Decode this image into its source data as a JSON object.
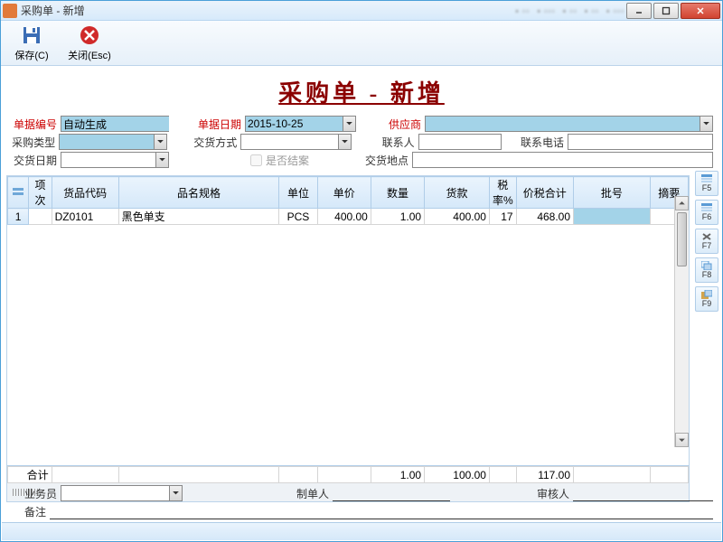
{
  "window_title": "采购单 - 新增",
  "toolbar": {
    "save": "保存(C)",
    "close": "关闭(Esc)"
  },
  "doc_title": "采购单 - 新增",
  "form": {
    "labels": {
      "doc_no": "单据编号",
      "doc_date": "单据日期",
      "supplier": "供应商",
      "ptype": "采购类型",
      "dmethod": "交货方式",
      "contact": "联系人",
      "phone": "联系电话",
      "ddate": "交货日期",
      "closed": "是否结案",
      "daddr": "交货地点"
    },
    "doc_no": "自动生成",
    "doc_date": "2015-10-25"
  },
  "columns": {
    "seq": "项次",
    "code": "货品代码",
    "name": "品名规格",
    "unit": "单位",
    "price": "单价",
    "qty": "数量",
    "amount": "货款",
    "rate": "税率%",
    "total": "价税合计",
    "batch": "批号",
    "note": "摘要"
  },
  "rows": [
    {
      "n": "1",
      "code": "DZ0101",
      "name": "黑色单支",
      "unit": "PCS",
      "price": "400.00",
      "qty": "1.00",
      "amount": "400.00",
      "rate": "17",
      "total": "468.00"
    }
  ],
  "sum": {
    "label": "合计",
    "qty": "1.00",
    "amount": "100.00",
    "total": "117.00"
  },
  "bottom": {
    "operator": "业务员",
    "maker": "制单人",
    "reviewer": "审核人",
    "remark": "备注"
  },
  "side": [
    "F5",
    "F6",
    "F7",
    "F8",
    "F9"
  ]
}
